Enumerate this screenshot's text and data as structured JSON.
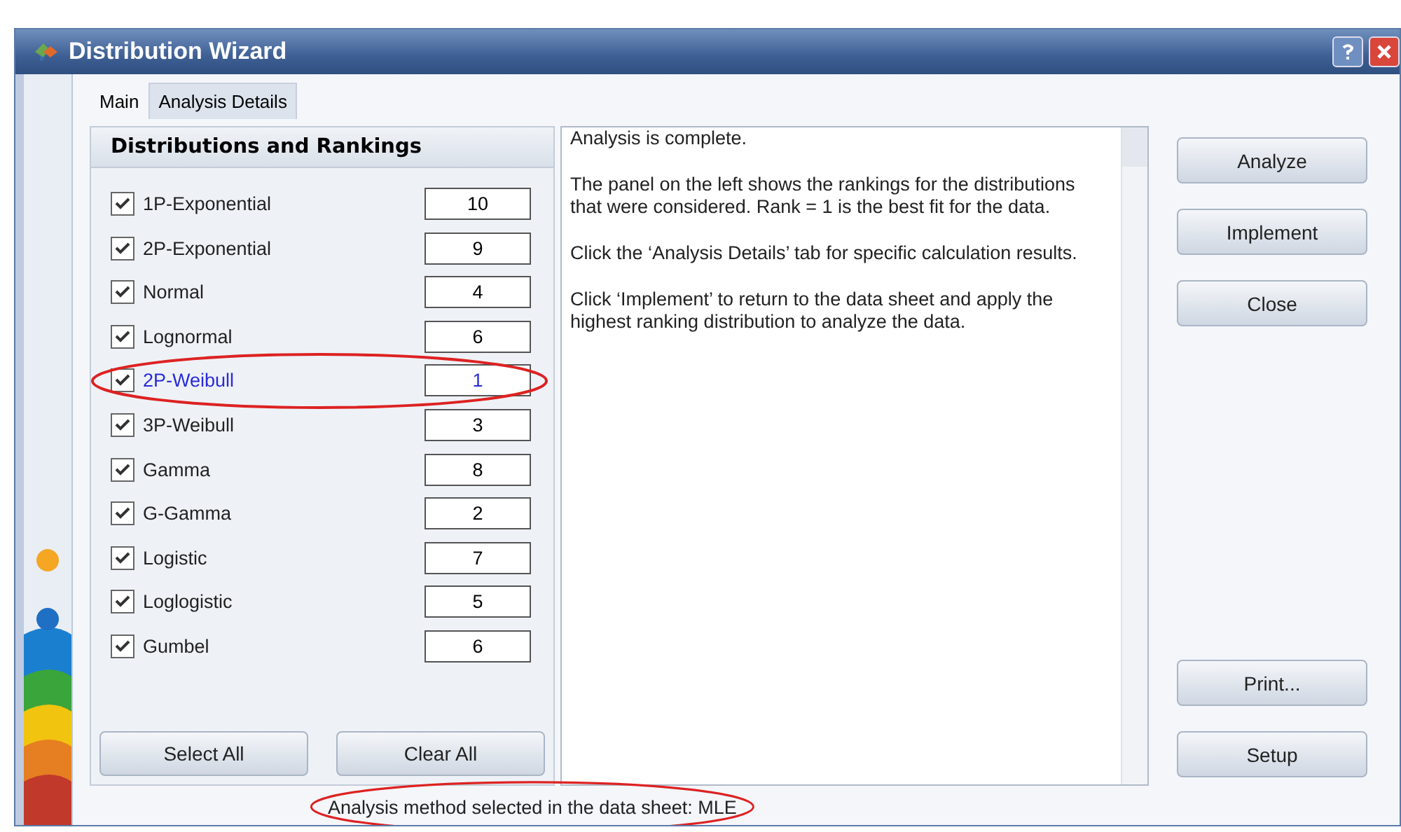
{
  "window": {
    "title": "Distribution Wizard"
  },
  "tabs": [
    {
      "label": "Main",
      "selected": true
    },
    {
      "label": "Analysis Details",
      "selected": false
    }
  ],
  "rankings": {
    "title": "Distributions and Rankings",
    "rows": [
      {
        "name": "1P-Exponential",
        "checked": true,
        "rank": "10",
        "selected": false,
        "circled": false
      },
      {
        "name": "2P-Exponential",
        "checked": true,
        "rank": "9",
        "selected": false,
        "circled": false
      },
      {
        "name": "Normal",
        "checked": true,
        "rank": "4",
        "selected": false,
        "circled": false
      },
      {
        "name": "Lognormal",
        "checked": true,
        "rank": "6",
        "selected": false,
        "circled": false
      },
      {
        "name": "2P-Weibull",
        "checked": true,
        "rank": "1",
        "selected": true,
        "circled": true
      },
      {
        "name": "3P-Weibull",
        "checked": true,
        "rank": "3",
        "selected": false,
        "circled": false
      },
      {
        "name": "Gamma",
        "checked": true,
        "rank": "8",
        "selected": false,
        "circled": false
      },
      {
        "name": "G-Gamma",
        "checked": true,
        "rank": "2",
        "selected": false,
        "circled": false
      },
      {
        "name": "Logistic",
        "checked": true,
        "rank": "7",
        "selected": false,
        "circled": false
      },
      {
        "name": "Loglogistic",
        "checked": true,
        "rank": "5",
        "selected": false,
        "circled": false
      },
      {
        "name": "Gumbel",
        "checked": true,
        "rank": "6",
        "selected": false,
        "circled": false
      }
    ],
    "buttons": [
      "Select All",
      "Clear All"
    ]
  },
  "message": [
    "Analysis is complete.",
    "The panel on the left shows the rankings for the distributions that were considered. Rank = 1 is the best fit for the data.",
    "Click the ‘Analysis Details’ tab for specific calculation results.",
    "Click ‘Implement’ to return to the data sheet and apply the highest ranking distribution to analyze the data."
  ],
  "side_buttons_top": [
    "Analyze",
    "Implement",
    "Close"
  ],
  "side_buttons_bottom": [
    "Print...",
    "Setup"
  ],
  "status": {
    "text": "Analysis method selected in the data sheet: MLE",
    "circled": true
  }
}
